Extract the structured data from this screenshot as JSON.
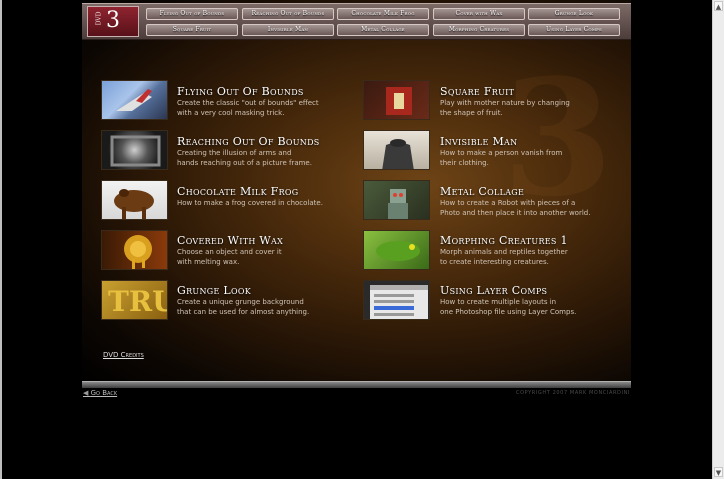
{
  "header": {
    "logo_text": "DVD",
    "logo_number": "3",
    "nav": [
      "Flying Out of Bounds",
      "Reaching Out of Bounds",
      "Chocolate Milk Frog",
      "Cover with Wax",
      "Grunge Look",
      "Square Fruit",
      "Invisible Man",
      "Metal Collage",
      "Morphing Creatures",
      "Using Layer Comps"
    ]
  },
  "tutorials": [
    {
      "title": "Flying Out Of Bounds",
      "desc1": "Create the classic \"out of bounds\" effect",
      "desc2": "with a very cool masking trick."
    },
    {
      "title": "Reaching Out Of Bounds",
      "desc1": "Creating the illusion of arms and",
      "desc2": "hands reaching out of a picture frame."
    },
    {
      "title": "Chocolate Milk Frog",
      "desc1": "How to make a frog covered in chocolate.",
      "desc2": ""
    },
    {
      "title": "Covered With Wax",
      "desc1": "Choose an object and cover it",
      "desc2": "with melting wax."
    },
    {
      "title": "Grunge Look",
      "desc1": "Create a unique grunge background",
      "desc2": "that can be used for almost anything."
    },
    {
      "title": "Square Fruit",
      "desc1": "Play with mother nature by changing",
      "desc2": "the shape of fruit."
    },
    {
      "title": "Invisible Man",
      "desc1": "How to make a person vanish from",
      "desc2": "their clothing."
    },
    {
      "title": "Metal Collage",
      "desc1": "How to create a Robot with pieces of a",
      "desc2": "Photo and then place it into another world."
    },
    {
      "title": "Morphing Creatures 1",
      "desc1": "Morph animals and reptiles together",
      "desc2": "to create interesting creatures."
    },
    {
      "title": "Using Layer Comps",
      "desc1": "How to create multiple layouts in",
      "desc2": "one Photoshop file using Layer Comps."
    }
  ],
  "watermark": "3",
  "thumb_text": {
    "grunge": "TRU"
  },
  "footer": {
    "credits": "DVD Credits",
    "go_back": "Go Back",
    "copyright": "COPYRIGHT 2007 MARK MONCIARDINI"
  },
  "scroll": {
    "up": "▲",
    "down": "▼"
  },
  "colors": {
    "background": "#000000",
    "panel": "#4c2c0c",
    "header": "#6a5856",
    "logo": "#8f2430",
    "title": "#ffffff",
    "desc": "#cfc3b6"
  }
}
